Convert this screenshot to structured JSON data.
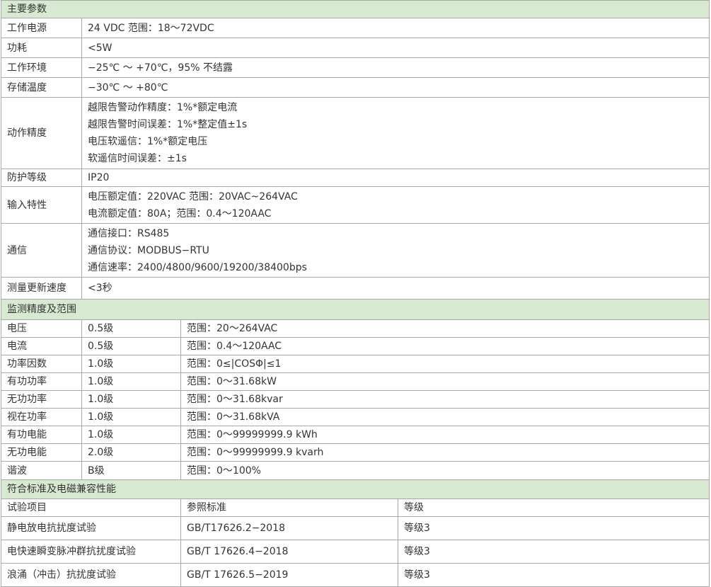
{
  "section1": {
    "title": "主要参数",
    "rows": [
      {
        "label": "工作电源",
        "lines": [
          "24 VDC 范围：18～72VDC"
        ]
      },
      {
        "label": "功耗",
        "lines": [
          "<5W"
        ]
      },
      {
        "label": "工作环境",
        "lines": [
          "−25℃ ～ +70℃，95% 不结露"
        ]
      },
      {
        "label": "存储温度",
        "lines": [
          "−30℃ ～ +80℃"
        ]
      },
      {
        "label": "动作精度",
        "lines": [
          "越限告警动作精度：1%*额定电流",
          "越限告警时间误差：1%*整定值±1s",
          "电压软遥信：1%*额定电压",
          "软遥信时间误差：±1s"
        ]
      },
      {
        "label": "防护等级",
        "lines": [
          "IP20"
        ]
      },
      {
        "label": "输入特性",
        "lines": [
          "电压额定值：220VAC 范围：20VAC~264VAC",
          "电流额定值：80A；范围：0.4～120AAC"
        ]
      },
      {
        "label": "通信",
        "lines": [
          "通信接口：RS485",
          "通信协议：MODBUS−RTU",
          "通信速率：2400/4800/9600/19200/38400bps"
        ]
      },
      {
        "label": "测量更新速度",
        "lines": [
          "<3秒"
        ]
      }
    ]
  },
  "section2": {
    "title": "监测精度及范围",
    "rows": [
      {
        "name": "电压",
        "grade": "0.5级",
        "range": "范围：20～264VAC"
      },
      {
        "name": "电流",
        "grade": "0.5级",
        "range": "范围：0.4～120AAC"
      },
      {
        "name": "功率因数",
        "grade": "1.0级",
        "range": "范围：0≤|COSΦ|≤1"
      },
      {
        "name": "有功功率",
        "grade": "1.0级",
        "range": "范围：0～31.68kW"
      },
      {
        "name": "无功功率",
        "grade": "1.0级",
        "range": "范围：0～31.68kvar"
      },
      {
        "name": "视在功率",
        "grade": "1.0级",
        "range": "范围：0～31.68kVA"
      },
      {
        "name": "有功电能",
        "grade": "1.0级",
        "range": "范围：0～99999999.9 kWh"
      },
      {
        "name": "无功电能",
        "grade": "2.0级",
        "range": "范围：0～99999999.9 kvarh"
      },
      {
        "name": "谐波",
        "grade": "B级",
        "range": "范围：0～100%"
      }
    ]
  },
  "section3": {
    "title": "符合标准及电磁兼容性能",
    "headers": [
      "试验项目",
      "参照标准",
      "等级"
    ],
    "rows": [
      {
        "item": "静电放电抗扰度试验",
        "standard": "GB/T17626.2−2018",
        "level": "等级3"
      },
      {
        "item": "电快速瞬变脉冲群抗扰度试验",
        "standard": "GB/T 17626.4−2018",
        "level": "等级3"
      },
      {
        "item": "浪涌（冲击）抗扰度试验",
        "standard": "GB/T 17626.5−2019",
        "level": "等级3"
      }
    ]
  }
}
